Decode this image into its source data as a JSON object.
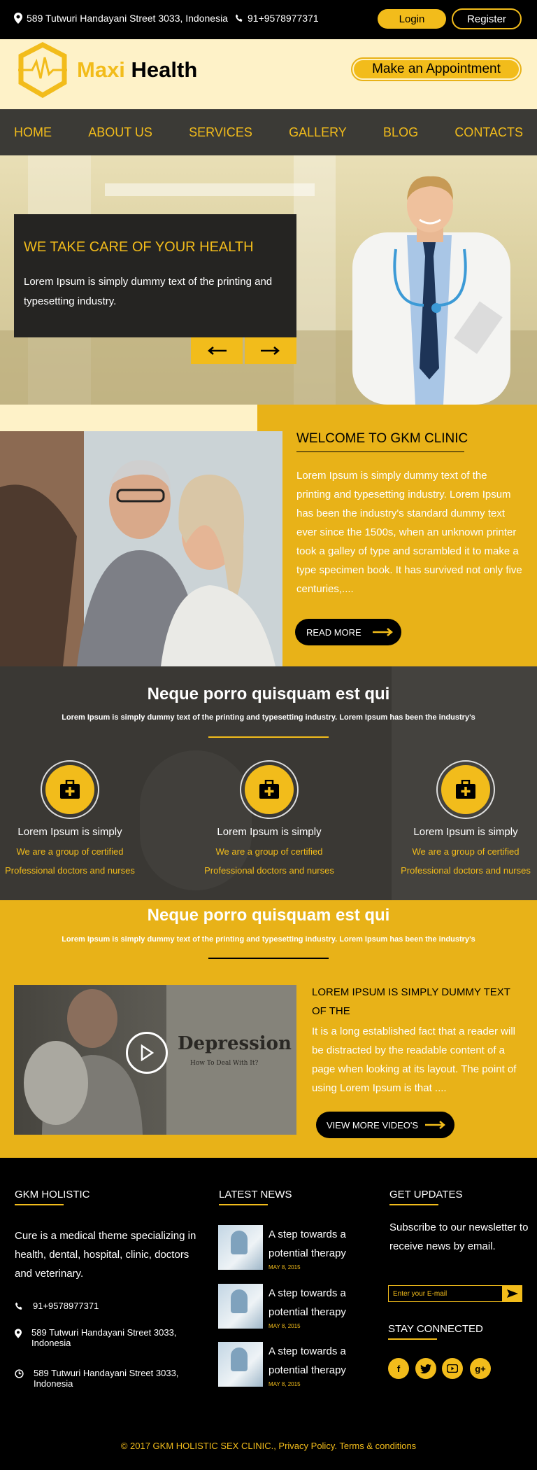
{
  "topbar": {
    "address": "589 Tutwuri Handayani Street 3033, Indonesia",
    "phone": "91+9578977371",
    "login": "Login",
    "register": "Register"
  },
  "header": {
    "brand_first": "Maxi",
    "brand_second": "Health",
    "appointment": "Make an Appointment"
  },
  "nav": [
    "HOME",
    "ABOUT US",
    "SERVICES",
    "GALLERY",
    "BLOG",
    "CONTACTS"
  ],
  "hero": {
    "title": "WE TAKE CARE OF YOUR HEALTH",
    "text": "Lorem Ipsum is simply dummy text of the printing and typesetting industry."
  },
  "welcome": {
    "title": "WELCOME TO GKM CLINIC",
    "text": "Lorem Ipsum is simply dummy text of the printing and typesetting industry. Lorem Ipsum has been the industry's standard dummy text ever since the 1500s, when an unknown printer took a galley of type and scrambled it to make a type specimen book. It has survived not only five centuries,....",
    "button": "READ MORE"
  },
  "features": {
    "title": "Neque porro quisquam est qui",
    "subtitle": "Lorem Ipsum is simply dummy text of the printing and typesetting industry. Lorem Ipsum has been the industry's",
    "items": [
      {
        "title": "Lorem Ipsum is simply",
        "text": "We are a group of certified Professional doctors and nurses"
      },
      {
        "title": "Lorem Ipsum is simply",
        "text": "We are a group of certified Professional doctors and nurses"
      },
      {
        "title": "Lorem Ipsum is simply",
        "text": "We are a group of certified Professional doctors and nurses"
      }
    ]
  },
  "video": {
    "title": "Neque porro quisquam est qui",
    "subtitle": "Lorem Ipsum is simply dummy text of the printing and typesetting industry. Lorem Ipsum has been the industry's",
    "thumb_title": "Depression",
    "thumb_sub": "How To Deal With It?",
    "heading": "LOREM IPSUM IS SIMPLY DUMMY TEXT OF THE",
    "text": "It is a long established fact that a reader will be distracted by the readable content of a page when looking at its layout. The point of using Lorem Ipsum is that ....",
    "button": "VIEW MORE VIDEO'S"
  },
  "footer": {
    "col1_title": "GKM HOLISTIC",
    "about": "Cure is a medical theme specializing in health, dental, hospital, clinic, doctors and veterinary.",
    "phone": "91+9578977371",
    "address1": "589 Tutwuri Handayani Street 3033, Indonesia",
    "address2": "589 Tutwuri Handayani Street 3033, Indonesia",
    "col2_title": "LATEST NEWS",
    "news": [
      {
        "title": "A step towards a potential therapy",
        "date": "MAY 8, 2015"
      },
      {
        "title": "A step towards a potential therapy",
        "date": "MAY 8, 2015"
      },
      {
        "title": "A step towards a potential therapy",
        "date": "MAY 8, 2015"
      }
    ],
    "col3_title": "GET UPDATES",
    "subscribe": "Subscribe to our newsletter to receive news by email.",
    "email_placeholder": "Enter your E-mail",
    "stay_title": "STAY CONNECTED",
    "copyright": "© 2017 GKM HOLISTIC SEX CLINIC., Privacy Policy. Terms & conditions"
  },
  "colors": {
    "accent": "#f2bc1b",
    "dark": "#000000",
    "cream": "#fef2c8"
  }
}
